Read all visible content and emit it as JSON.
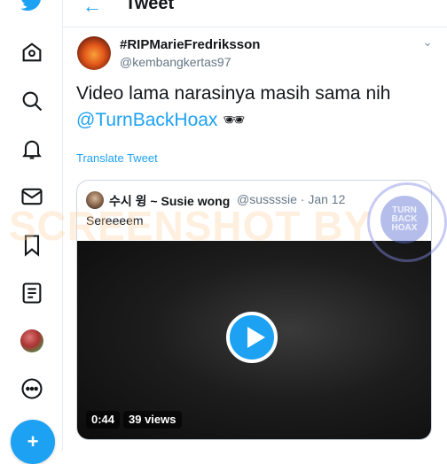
{
  "header": {
    "title": "Tweet"
  },
  "sidebar": {
    "icons": [
      "twitter-bird-icon",
      "home-icon",
      "explore-icon",
      "notifications-icon",
      "messages-icon",
      "bookmarks-icon",
      "lists-icon",
      "profile-avatar",
      "more-icon"
    ],
    "compose_label": "+"
  },
  "tweet": {
    "display_name": "#RIPMarieFredriksson",
    "handle": "@kembangkertas97",
    "text": "Video lama narasinya masih sama nih",
    "mention": "@TurnBackHoax",
    "emoji": "🕶",
    "translate": "Translate Tweet"
  },
  "quote": {
    "name": "수시 윙 ~ Susie wong",
    "handle_date": "@sussssie · Jan 12",
    "text": "Sereeeem",
    "duration": "0:44",
    "views": "39 views"
  },
  "overlay": {
    "watermark": "SCREENSHOT BY",
    "seal_text": "TURN BACK HOAX"
  },
  "colors": {
    "accent": "#1da1f2",
    "text": "#14171a",
    "muted": "#657786"
  }
}
